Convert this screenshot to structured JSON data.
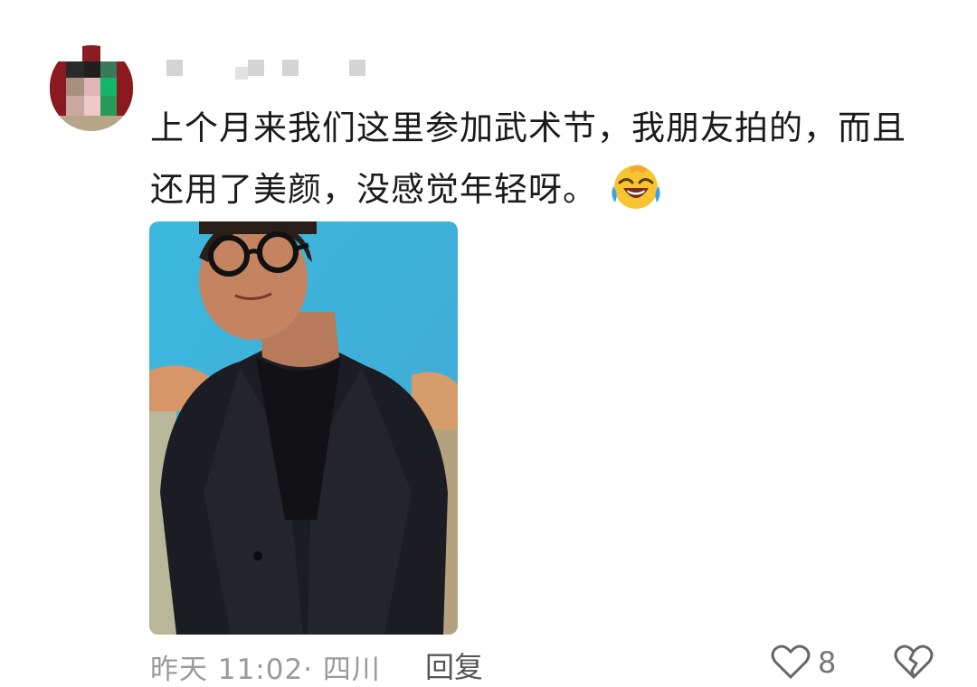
{
  "comment": {
    "text": "上个月来我们这里参加武术节，我朋友拍的，而且还用了美颜，没感觉年轻呀。",
    "emoji": "crying-laughing-emoji"
  },
  "meta": {
    "time_location": "昨天 11:02· 四川",
    "reply_label": "回复",
    "like_count": "8"
  },
  "icons": {
    "like": "heart-outline-icon",
    "dislike": "broken-heart-icon"
  },
  "colors": {
    "text": "#1a1a1a",
    "meta_text": "#9a9a9a",
    "photo_background": "#3fb4da"
  }
}
